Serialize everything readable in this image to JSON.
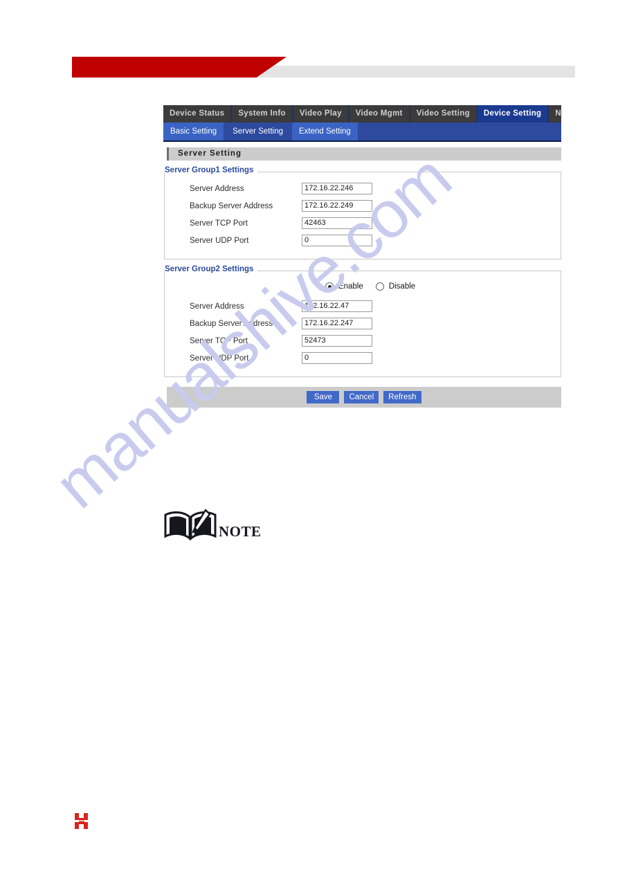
{
  "header": {
    "accent_color": "#c00000",
    "bar_color": "#e4e4e4"
  },
  "web_ui": {
    "main_tabs": [
      {
        "label": "Device Status",
        "active": false
      },
      {
        "label": "System Info",
        "active": false
      },
      {
        "label": "Video Play",
        "active": false
      },
      {
        "label": "Video Mgmt",
        "active": false
      },
      {
        "label": "Video Setting",
        "active": false
      },
      {
        "label": "Device Setting",
        "active": true
      },
      {
        "label": "Network Sett",
        "active": false
      }
    ],
    "sub_tabs": [
      {
        "label": "Basic Setting",
        "active": false
      },
      {
        "label": "Server Setting",
        "active": true
      },
      {
        "label": "Extend Setting",
        "active": false
      }
    ],
    "panel_title": "Server Setting",
    "groups": [
      {
        "legend": "Server Group1 Settings",
        "has_toggle": false,
        "fields": [
          {
            "label": "Server Address",
            "value": "172.16.22.246"
          },
          {
            "label": "Backup Server Address",
            "value": "172.16.22.249"
          },
          {
            "label": "Server TCP Port",
            "value": "42463"
          },
          {
            "label": "Server UDP Port",
            "value": "0"
          }
        ]
      },
      {
        "legend": "Server Group2 Settings",
        "has_toggle": true,
        "toggle": {
          "enable_label": "Enable",
          "disable_label": "Disable",
          "selected": "Enable"
        },
        "fields": [
          {
            "label": "Server Address",
            "value": "172.16.22.47"
          },
          {
            "label": "Backup Server Address",
            "value": "172.16.22.247"
          },
          {
            "label": "Server TCP Port",
            "value": "52473"
          },
          {
            "label": "Server UDP Port",
            "value": "0"
          }
        ]
      }
    ],
    "buttons": [
      {
        "label": "Save"
      },
      {
        "label": "Cancel"
      },
      {
        "label": "Refresh"
      }
    ],
    "accent_button_color": "#4169c8",
    "active_tab_color": "#1a3a8f"
  },
  "note": {
    "label": "NOTE"
  },
  "watermark": {
    "text": "manualshive.com",
    "color": "#c9cbee"
  },
  "footer": {
    "logo_color": "#d8241f"
  }
}
